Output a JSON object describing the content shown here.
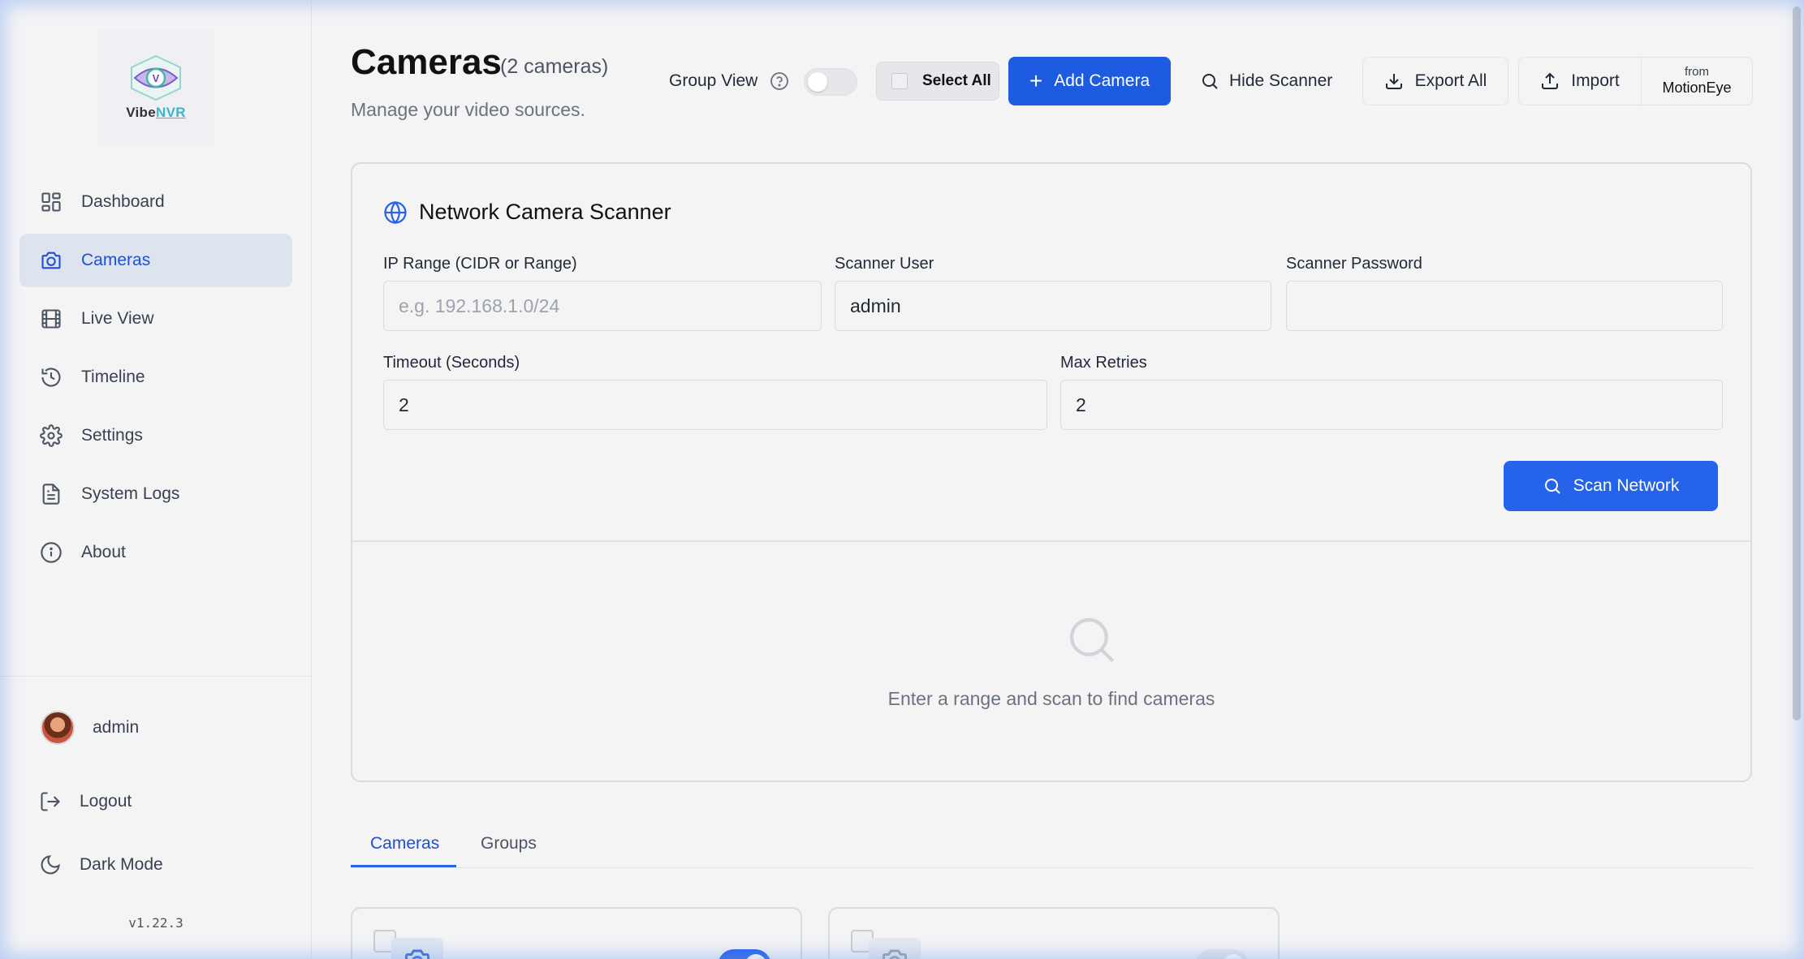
{
  "brand": {
    "name_a": "Vibe",
    "name_b": "NVR"
  },
  "sidebar": {
    "items": [
      {
        "label": "Dashboard",
        "icon": "dashboard-icon"
      },
      {
        "label": "Cameras",
        "icon": "camera-icon",
        "active": true
      },
      {
        "label": "Live View",
        "icon": "film-icon"
      },
      {
        "label": "Timeline",
        "icon": "history-icon"
      },
      {
        "label": "Settings",
        "icon": "gear-icon"
      },
      {
        "label": "System Logs",
        "icon": "file-text-icon"
      },
      {
        "label": "About",
        "icon": "info-icon"
      }
    ],
    "user": "admin",
    "logout": "Logout",
    "dark_mode": "Dark Mode",
    "version": "v1.22.3"
  },
  "header": {
    "title": "Cameras",
    "count": "(2 cameras)",
    "subtitle": "Manage your video sources.",
    "group_view": "Group View",
    "select_all": "Select All",
    "add_camera": "Add Camera",
    "hide_scanner": "Hide Scanner",
    "export_all": "Export All",
    "import": "Import",
    "from": "from",
    "motioneye": "MotionEye"
  },
  "scanner": {
    "title": "Network Camera Scanner",
    "ip_label": "IP Range (CIDR or Range)",
    "ip_placeholder": "e.g. 192.168.1.0/24",
    "ip_value": "",
    "user_label": "Scanner User",
    "user_value": "admin",
    "password_label": "Scanner Password",
    "password_value": "",
    "timeout_label": "Timeout (Seconds)",
    "timeout_value": "2",
    "retries_label": "Max Retries",
    "retries_value": "2",
    "scan_button": "Scan Network",
    "empty_text": "Enter a range and scan to find cameras"
  },
  "tabs": [
    {
      "label": "Cameras",
      "active": true
    },
    {
      "label": "Groups"
    }
  ],
  "colors": {
    "accent": "#2563eb",
    "active_nav_bg": "#dde4ee"
  }
}
